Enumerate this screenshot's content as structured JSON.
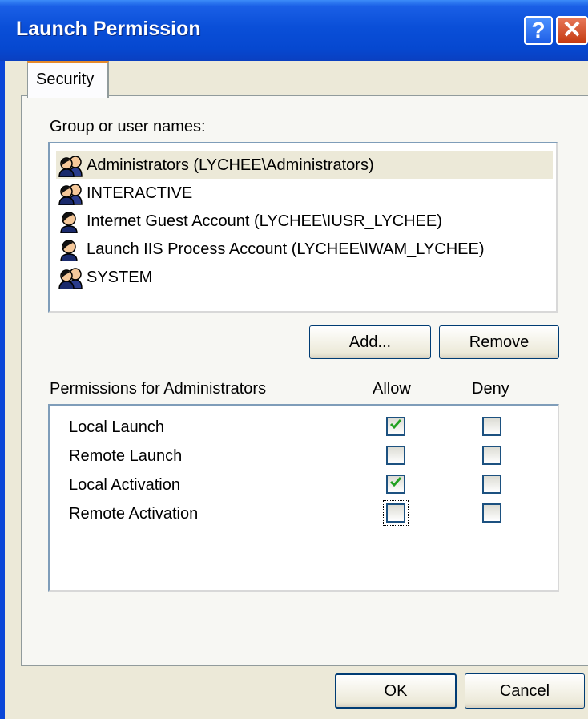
{
  "window": {
    "title": "Launch Permission",
    "help_glyph": "?",
    "close_glyph": "✕"
  },
  "tabs": [
    {
      "label": "Security",
      "active": true
    }
  ],
  "groups": {
    "label": "Group or user names:",
    "items": [
      {
        "name": "Administrators (LYCHEE\\Administrators)",
        "icon": "group-users-icon",
        "selected": true
      },
      {
        "name": "INTERACTIVE",
        "icon": "group-users-icon",
        "selected": false
      },
      {
        "name": "Internet Guest Account (LYCHEE\\IUSR_LYCHEE)",
        "icon": "user-icon",
        "selected": false
      },
      {
        "name": "Launch IIS Process Account (LYCHEE\\IWAM_LYCHEE)",
        "icon": "user-icon",
        "selected": false
      },
      {
        "name": "SYSTEM",
        "icon": "group-users-icon",
        "selected": false
      }
    ]
  },
  "buttons": {
    "add": "Add...",
    "remove": "Remove",
    "ok": "OK",
    "cancel": "Cancel"
  },
  "permissions": {
    "label": "Permissions for Administrators",
    "allow_header": "Allow",
    "deny_header": "Deny",
    "rows": [
      {
        "name": "Local Launch",
        "allow": true,
        "deny": false
      },
      {
        "name": "Remote Launch",
        "allow": false,
        "deny": false
      },
      {
        "name": "Local Activation",
        "allow": true,
        "deny": false
      },
      {
        "name": "Remote Activation",
        "allow": false,
        "deny": false,
        "focused": true
      }
    ]
  },
  "colors": {
    "check": "#21a121",
    "titlebar": "#0a4fd8",
    "selection": "#ece9d8"
  }
}
